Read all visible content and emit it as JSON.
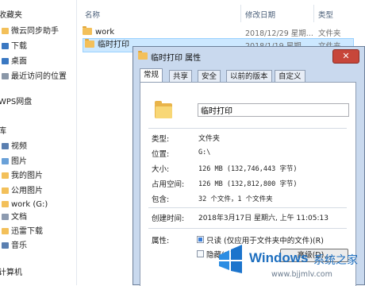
{
  "sidebar": {
    "items": [
      {
        "label": "收藏夹",
        "icon": "star-icon",
        "color": "#f0c040"
      },
      {
        "label": "微云同步助手",
        "icon": "cloud-folder-icon",
        "color": "#f3c05a"
      },
      {
        "label": "下载",
        "icon": "download-icon",
        "color": "#3a78c2"
      },
      {
        "label": "桌面",
        "icon": "desktop-icon",
        "color": "#3a78c2"
      },
      {
        "label": "最近访问的位置",
        "icon": "recent-icon",
        "color": "#8a97a8"
      },
      {
        "label": "WPS网盘",
        "icon": "cloud-drive-icon",
        "color": "#cfd6df"
      },
      {
        "label": "库",
        "icon": "library-icon",
        "color": "#e0b85b"
      },
      {
        "label": "视频",
        "icon": "video-icon",
        "color": "#5a7fb0"
      },
      {
        "label": "图片",
        "icon": "picture-icon",
        "color": "#6aa1d8"
      },
      {
        "label": "我的图片",
        "icon": "folder-icon",
        "color": "#f3c05a"
      },
      {
        "label": "公用图片",
        "icon": "folder-icon",
        "color": "#f3c05a"
      },
      {
        "label": "work (G:)",
        "icon": "drive-icon",
        "color": "#f3c05a"
      },
      {
        "label": "文档",
        "icon": "document-icon",
        "color": "#8d9bb0"
      },
      {
        "label": "迅雷下载",
        "icon": "folder-icon",
        "color": "#f3c05a"
      },
      {
        "label": "音乐",
        "icon": "music-icon",
        "color": "#5a7fb0"
      },
      {
        "label": "计算机",
        "icon": "computer-icon",
        "color": "#7f8ea3"
      }
    ]
  },
  "file_list": {
    "columns": [
      "名称",
      "修改日期",
      "类型"
    ],
    "rows": [
      {
        "name": "work",
        "date": "2018/12/29 星期...",
        "type": "文件夹"
      },
      {
        "name": "临时打印",
        "date": "2018/1/19 星期...",
        "type": "文件夹"
      }
    ]
  },
  "dialog": {
    "title": "临时打印 属性",
    "close_symbol": "✕",
    "tabs": [
      "常规",
      "共享",
      "安全",
      "以前的版本",
      "自定义"
    ],
    "folder_name": "临时打印",
    "properties": [
      {
        "label": "类型:",
        "value": "文件夹"
      },
      {
        "label": "位置:",
        "value": "G:\\"
      },
      {
        "label": "大小:",
        "value": "126 MB (132,746,443 字节)"
      },
      {
        "label": "占用空间:",
        "value": "126 MB (132,812,800 字节)"
      },
      {
        "label": "包含:",
        "value": "32 个文件，1 个文件夹"
      },
      {
        "label": "创建时间:",
        "value": "2018年3月17日 星期六, 上午 11:05:13"
      }
    ],
    "attributes_label": "属性:",
    "readonly_label": "只读 (仅应用于文件夹中的文件)(R)",
    "hidden_label": "隐藏(H)",
    "advanced_label": "高级(D)..."
  },
  "watermark": {
    "brand": "Windows",
    "suffix": "系统之家",
    "url": "www.bjjmlv.com"
  }
}
